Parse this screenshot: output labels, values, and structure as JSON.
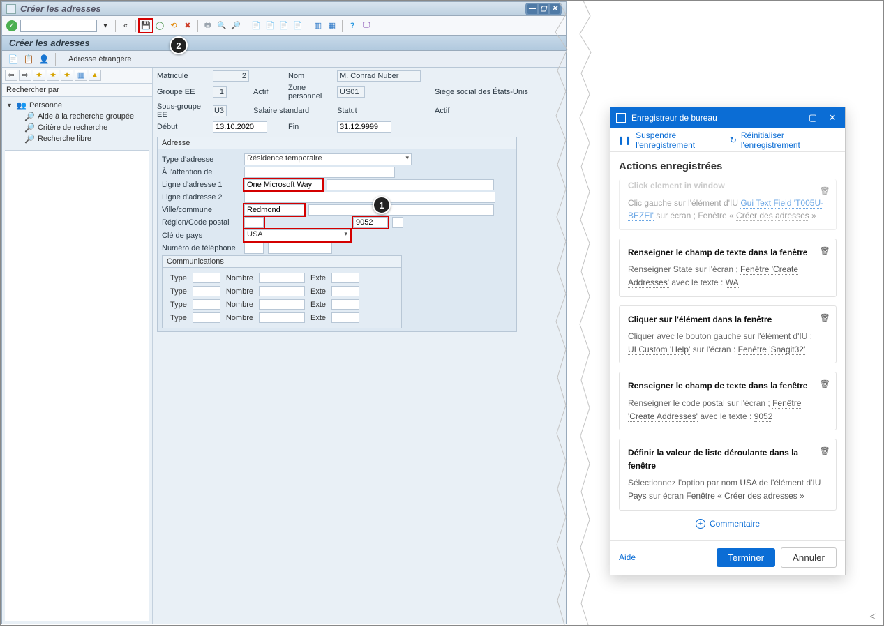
{
  "sap": {
    "window_title": "Créer les adresses",
    "subtitle": "Créer les adresses",
    "subtoolbar_text": "Adresse étrangère",
    "win_controls": {
      "min": "—",
      "max": "▢",
      "close": "✕"
    },
    "toolbar": {
      "ok": "✓",
      "chev": "«",
      "save": "💾",
      "back_green": "◯",
      "exit_orange": "⟲",
      "cancel_red": "✖",
      "print": "🖶",
      "find": "🔍",
      "findnext": "🔎",
      "page1": "📄",
      "page2": "📄",
      "page3": "📄",
      "page4": "📄",
      "layout1": "▥",
      "layout2": "▦",
      "help": "?",
      "rec": "🖵"
    },
    "left": {
      "search_by": "Rechercher par",
      "root": "Personne",
      "children": [
        "Aide à la recherche groupée",
        "Critère de recherche",
        "Recherche libre"
      ]
    },
    "hdr": {
      "matricule_l": "Matricule",
      "matricule_v": "2",
      "nom_l": "Nom",
      "nom_v": "M. Conrad Nuber",
      "groupe_l": "Groupe EE",
      "groupe_v": "1",
      "groupe_t": "Actif",
      "zone_l": "Zone personnel",
      "zone_v": "US01",
      "zone_t": "Siège social des États-Unis",
      "sousgroupe_l": "Sous-groupe EE",
      "sousgroupe_v": "U3",
      "sousgroupe_t": "Salaire standard",
      "statut_l": "Statut",
      "statut_v": "Actif",
      "debut_l": "Début",
      "debut_v": "13.10.2020",
      "fin_l": "Fin",
      "fin_v": "31.12.9999"
    },
    "addr": {
      "box": "Adresse",
      "type_l": "Type d'adresse",
      "type_v": "Résidence temporaire",
      "att_l": "À l'attention de",
      "att_v": "",
      "l1_l": "Ligne d'adresse 1",
      "l1_v": "One Microsoft Way",
      "l2_l": "Ligne d'adresse 2",
      "l2_v": "",
      "city_l": "Ville/commune",
      "city_v": "Redmond",
      "region_l": "Région/Code postal",
      "region_v": "",
      "postal_v": "9052",
      "country_l": "Clé de pays",
      "country_v": "USA",
      "tel_l": "Numéro de téléphone",
      "tel_area": "",
      "tel_num": ""
    },
    "comm": {
      "box": "Communications",
      "type_l": "Type",
      "num_l": "Nombre",
      "ext_l": "Exte"
    }
  },
  "recorder": {
    "title": "Enregistreur de bureau",
    "pause": "Suspendre l'enregistrement",
    "reset": "Réinitialiser l'enregistrement",
    "heading": "Actions enregistrées",
    "cards": [
      {
        "title": "Click element in window",
        "text_pre": "Clic gauche sur l'élément d'IU ",
        "link1": "Gui Text Field 'T005U-BEZEI'",
        "text_mid": " sur écran ; Fenêtre « ",
        "link2": "Créer des adresses",
        "text_post": " »",
        "faded": true
      },
      {
        "title": "Renseigner le champ de texte dans la fenêtre",
        "text_pre": "Renseigner State sur l'écran ; ",
        "link1": "Fenêtre 'Create Addresses'",
        "text_mid": " avec le texte : ",
        "link2": "WA",
        "text_post": ""
      },
      {
        "title": "Cliquer sur l'élément dans la fenêtre",
        "text_pre": "Cliquer avec le bouton gauche sur l'élément d'IU : ",
        "link1": "UI Custom 'Help'",
        "text_mid": " sur l'écran : ",
        "link2": "Fenêtre 'Snagit32'",
        "text_post": ""
      },
      {
        "title": "Renseigner le champ de texte dans la fenêtre",
        "text_pre": "Renseigner le code postal sur l'écran ; ",
        "link1": "Fenêtre 'Create Addresses'",
        "text_mid": " avec le texte : ",
        "link2": "9052",
        "text_post": ""
      },
      {
        "title": "Définir la valeur de liste déroulante dans la fenêtre",
        "text_pre": "Sélectionnez l'option par nom ",
        "link1": "USA",
        "text_mid": " de l'élément d'IU ",
        "link2": "Pays",
        "text_post2_pre": " sur écran ",
        "link3": "Fenêtre « Créer des adresses »",
        "text_post": ""
      }
    ],
    "comment": "Commentaire",
    "help": "Aide",
    "done": "Terminer",
    "cancel": "Annuler"
  },
  "callouts": {
    "one": "1",
    "two": "2"
  }
}
